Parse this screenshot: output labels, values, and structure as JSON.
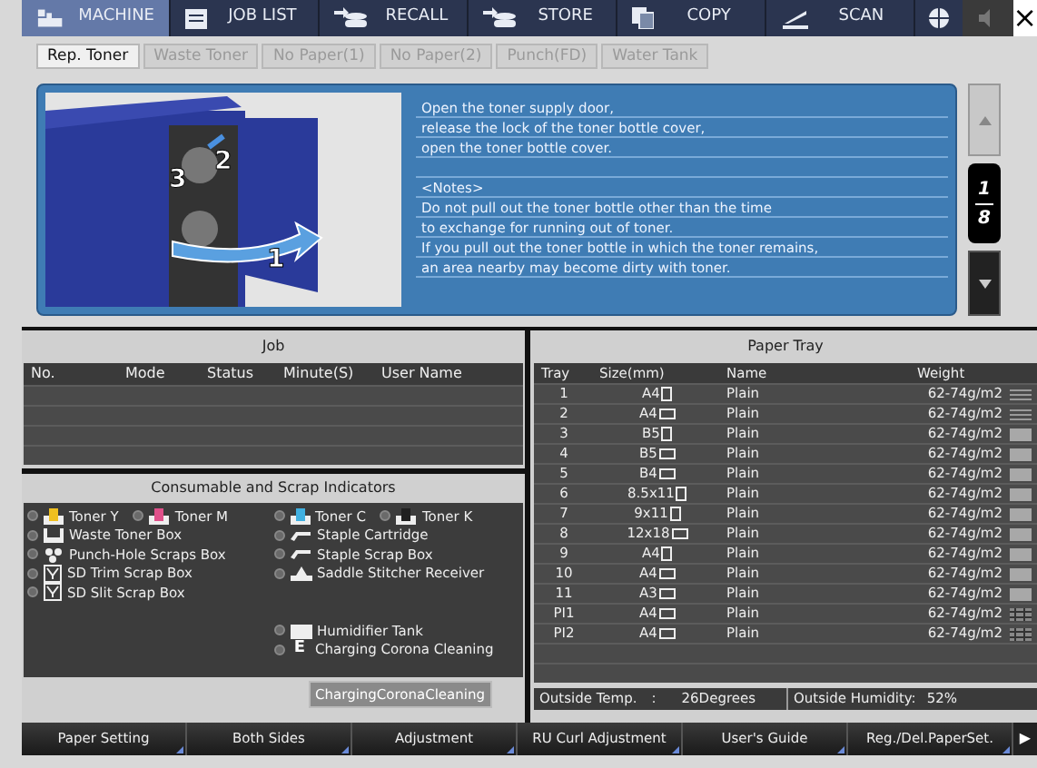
{
  "top_tabs": [
    {
      "label": "MACHINE",
      "kind": "machine",
      "selected": true
    },
    {
      "label": "JOB LIST",
      "kind": "list",
      "selected": false
    },
    {
      "label": "RECALL",
      "kind": "recall",
      "selected": false
    },
    {
      "label": "STORE",
      "kind": "store",
      "selected": false
    },
    {
      "label": "COPY",
      "kind": "copy",
      "selected": false
    },
    {
      "label": "SCAN",
      "kind": "scan",
      "selected": false
    }
  ],
  "close_label": "×",
  "sub_tabs": [
    {
      "label": "Rep. Toner",
      "selected": true,
      "disabled": false
    },
    {
      "label": "Waste Toner",
      "selected": false,
      "disabled": true
    },
    {
      "label": "No Paper(1)",
      "selected": false,
      "disabled": true
    },
    {
      "label": "No Paper(2)",
      "selected": false,
      "disabled": true
    },
    {
      "label": "Punch(FD)",
      "selected": false,
      "disabled": true
    },
    {
      "label": "Water Tank",
      "selected": false,
      "disabled": true
    }
  ],
  "guide": {
    "callouts": [
      "1",
      "2",
      "3"
    ],
    "steps": [
      "Open the toner supply door,",
      "release the lock of the toner bottle cover,",
      "open the toner bottle cover."
    ],
    "notes": [
      "<Notes>",
      "Do not pull out the toner bottle other than the time",
      "to exchange for running out of toner.",
      "If you pull out the toner bottle in which the toner remains,",
      "an area nearby may become dirty with toner."
    ],
    "page": "1",
    "pages": "8"
  },
  "job": {
    "title": "Job",
    "columns": [
      "No.",
      "Mode",
      "Status",
      "Minute(S)",
      "User Name"
    ]
  },
  "consumables": {
    "title": "Consumable and Scrap Indicators",
    "left": [
      [
        {
          "label": "Toner Y",
          "kind": "toner",
          "color": "#f0c020"
        },
        {
          "label": "Toner M",
          "kind": "toner",
          "color": "#e0508a"
        }
      ],
      [
        {
          "label": "Waste Toner Box",
          "kind": "waste"
        }
      ],
      [
        {
          "label": "Punch-Hole Scraps Box",
          "kind": "punch"
        }
      ],
      [
        {
          "label": "SD Trim Scrap Box",
          "kind": "sd"
        }
      ],
      [
        {
          "label": "SD Slit Scrap Box",
          "kind": "sd"
        }
      ]
    ],
    "right": [
      [
        {
          "label": "Toner C",
          "kind": "toner",
          "color": "#40b0e0"
        },
        {
          "label": "Toner K",
          "kind": "toner",
          "color": "#202020"
        }
      ],
      [
        {
          "label": "Staple Cartridge",
          "kind": "staple"
        }
      ],
      [
        {
          "label": "Staple Scrap Box",
          "kind": "staple"
        }
      ],
      [
        {
          "label": "Saddle Stitcher Receiver",
          "kind": "saddle"
        }
      ]
    ],
    "right_bottom": [
      [
        {
          "label": "Humidifier Tank",
          "kind": "tank"
        }
      ],
      [
        {
          "label": "Charging Corona Cleaning",
          "kind": "letter",
          "glyph": "E"
        }
      ]
    ],
    "button": "ChargingCoronaCleaning"
  },
  "paper_tray": {
    "title": "Paper Tray",
    "columns": [
      "Tray",
      "Size(mm)",
      "Name",
      "Weight"
    ],
    "rows": [
      {
        "tray": "1",
        "size": "A4",
        "paper": {
          "kind": "portrait"
        },
        "name": "Plain",
        "weight": "62-74g/m2",
        "swatch": {
          "kind": "lines"
        }
      },
      {
        "tray": "2",
        "size": "A4",
        "paper": {
          "kind": "landscape"
        },
        "name": "Plain",
        "weight": "62-74g/m2",
        "swatch": {
          "kind": "lines"
        }
      },
      {
        "tray": "3",
        "size": "B5",
        "paper": {
          "kind": "portrait"
        },
        "name": "Plain",
        "weight": "62-74g/m2",
        "swatch": {
          "kind": "solid"
        }
      },
      {
        "tray": "4",
        "size": "B5",
        "paper": {
          "kind": "landscape"
        },
        "name": "Plain",
        "weight": "62-74g/m2",
        "swatch": {
          "kind": "solid"
        }
      },
      {
        "tray": "5",
        "size": "B4",
        "paper": {
          "kind": "landscape"
        },
        "name": "Plain",
        "weight": "62-74g/m2",
        "swatch": {
          "kind": "solid"
        }
      },
      {
        "tray": "6",
        "size": "8.5x11",
        "paper": {
          "kind": "portrait"
        },
        "name": "Plain",
        "weight": "62-74g/m2",
        "swatch": {
          "kind": "solid"
        }
      },
      {
        "tray": "7",
        "size": "9x11",
        "paper": {
          "kind": "portrait"
        },
        "name": "Plain",
        "weight": "62-74g/m2",
        "swatch": {
          "kind": "solid"
        }
      },
      {
        "tray": "8",
        "size": "12x18",
        "paper": {
          "kind": "landscape"
        },
        "name": "Plain",
        "weight": "62-74g/m2",
        "swatch": {
          "kind": "solid"
        }
      },
      {
        "tray": "9",
        "size": "A4",
        "paper": {
          "kind": "portrait"
        },
        "name": "Plain",
        "weight": "62-74g/m2",
        "swatch": {
          "kind": "solid"
        }
      },
      {
        "tray": "10",
        "size": "A4",
        "paper": {
          "kind": "landscape"
        },
        "name": "Plain",
        "weight": "62-74g/m2",
        "swatch": {
          "kind": "solid"
        }
      },
      {
        "tray": "11",
        "size": "A3",
        "paper": {
          "kind": "landscape"
        },
        "name": "Plain",
        "weight": "62-74g/m2",
        "swatch": {
          "kind": "solid"
        }
      },
      {
        "tray": "PI1",
        "size": "A4",
        "paper": {
          "kind": "landscape"
        },
        "name": "Plain",
        "weight": "62-74g/m2",
        "swatch": {
          "kind": "pattern"
        }
      },
      {
        "tray": "PI2",
        "size": "A4",
        "paper": {
          "kind": "landscape"
        },
        "name": "Plain",
        "weight": "62-74g/m2",
        "swatch": {
          "kind": "pattern"
        }
      }
    ],
    "temp_label": "Outside Temp.",
    "temp_sep": ":",
    "temp_value": "26Degrees",
    "humidity_label": "Outside Humidity:",
    "humidity_value": "52%"
  },
  "bottom_buttons": [
    "Paper Setting",
    "Both Sides",
    "Adjustment",
    "RU Curl Adjustment",
    "User's Guide",
    "Reg./Del.PaperSet."
  ],
  "next_label": "▶"
}
